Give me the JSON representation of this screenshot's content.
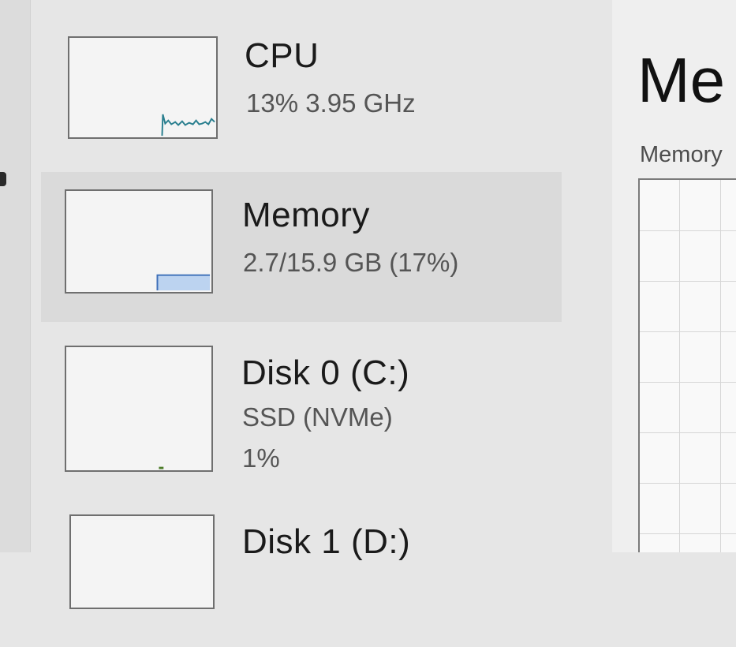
{
  "sidebar": {
    "items": [
      {
        "title": "CPU",
        "sub": "13% 3.95 GHz",
        "sub2": "",
        "selected": false
      },
      {
        "title": "Memory",
        "sub": "2.7/15.9 GB (17%)",
        "sub2": "",
        "selected": true
      },
      {
        "title": "Disk 0 (C:)",
        "sub": "SSD (NVMe)",
        "sub2": "1%",
        "selected": false
      },
      {
        "title": "Disk 1 (D:)",
        "sub": "",
        "sub2": "",
        "selected": false
      }
    ]
  },
  "detail": {
    "title": "Me",
    "graph_label": "Memory"
  },
  "colors": {
    "cpu_line": "#2a7f8f",
    "memory_fill": "#bcd3f0",
    "memory_stroke": "#3d6fb8",
    "selected_bg": "#dadada"
  }
}
